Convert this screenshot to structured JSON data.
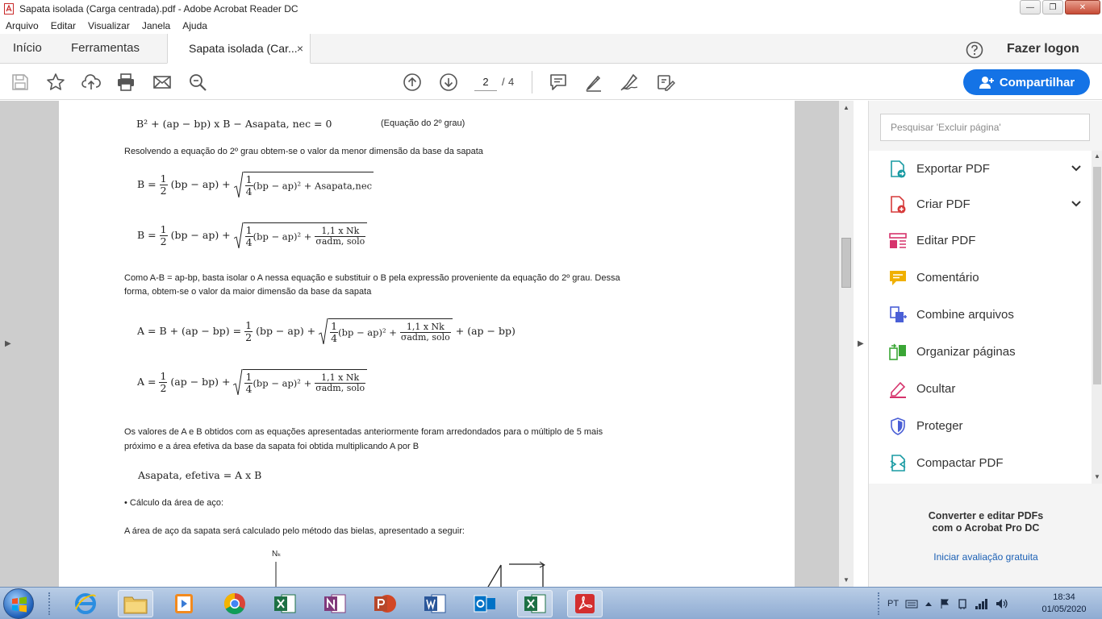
{
  "window": {
    "title": "Sapata isolada (Carga centrada).pdf - Adobe Acrobat Reader DC",
    "minimize": "—",
    "maximize": "❐",
    "close": "✕"
  },
  "menu": [
    "Arquivo",
    "Editar",
    "Visualizar",
    "Janela",
    "Ajuda"
  ],
  "tabs": {
    "home": "Início",
    "tools": "Ferramentas",
    "document": "Sapata isolada (Car...",
    "close": "×"
  },
  "header": {
    "login": "Fazer logon"
  },
  "toolbar": {
    "page_current": "2",
    "page_separator": "/",
    "page_total": "4",
    "share_label": "Compartilhar",
    "icons": [
      "save-icon",
      "star-icon",
      "upload-icon",
      "print-icon",
      "email-icon",
      "zoom-icon",
      "arrow-up-icon",
      "arrow-down-icon",
      "comment-icon",
      "pen-icon",
      "sign-icon",
      "edit-icon"
    ]
  },
  "document": {
    "eq1": {
      "text": "B² + (ap − bp) x B − Asapata, nec = 0",
      "note": "(Equação do 2º grau)"
    },
    "para1": "Resolvendo a equação do 2º grau obtem-se o valor da menor dimensão da base da sapata",
    "eq2": {
      "lhs": "B =",
      "frac_num": "1",
      "frac_den": "2",
      "term1": "(bp − ap) +",
      "inner_num": "1",
      "inner_den": "4",
      "inner_term": "(bp − ap)² + Asapata,nec"
    },
    "eq3": {
      "lhs": "B =",
      "frac_num": "1",
      "frac_den": "2",
      "term1": "(bp − ap) +",
      "inner_num": "1",
      "inner_den": "4",
      "inner_term": "(bp − ap)² +",
      "frac2_num": "1,1 x Nk",
      "frac2_den": "σadm, solo"
    },
    "para2_line1": "Como A-B = ap-bp, basta isolar o A nessa equação e substituir o B pela expressão proveniente da equação do 2º grau. Dessa",
    "para2_line2": "forma, obtem-se o valor da maior dimensão da base da sapata",
    "eq4": {
      "lhs": "A = B + (ap − bp) =",
      "frac_num": "1",
      "frac_den": "2",
      "term1": "(bp − ap) +",
      "inner_num": "1",
      "inner_den": "4",
      "inner_term": "(bp − ap)² +",
      "frac2_num": "1,1 x Nk",
      "frac2_den": "σadm, solo",
      "tail": "+ (ap − bp)"
    },
    "eq5": {
      "lhs": "A =",
      "frac_num": "1",
      "frac_den": "2",
      "term1": "(ap − bp) +",
      "inner_num": "1",
      "inner_den": "4",
      "inner_term": "(bp − ap)² +",
      "frac2_num": "1,1 x Nk",
      "frac2_den": "σadm, solo"
    },
    "para3_line1": "Os valores de A e B obtidos com as equações apresentadas anteriormente foram arredondados para o múltiplo de 5 mais",
    "para3_line2": "próximo e a área efetiva da base da sapata foi obtida multiplicando A por B",
    "eq6": "Asapata, efetiva = A x B",
    "bullet": "• Cálculo da área de aço:",
    "para4": "A área de aço da sapata será calculado pelo método das bielas, apresentado a seguir:",
    "diagram_label": "Nₖ"
  },
  "right_panel": {
    "search_placeholder": "Pesquisar 'Excluir página'",
    "tools": [
      {
        "label": "Exportar PDF",
        "icon": "export-pdf-icon",
        "color": "#1a9ba3",
        "expandable": true
      },
      {
        "label": "Criar PDF",
        "icon": "create-pdf-icon",
        "color": "#d63a3a",
        "expandable": true
      },
      {
        "label": "Editar PDF",
        "icon": "edit-pdf-icon",
        "color": "#d6336c",
        "expandable": false
      },
      {
        "label": "Comentário",
        "icon": "comment-icon",
        "color": "#f0b000",
        "expandable": false
      },
      {
        "label": "Combine arquivos",
        "icon": "combine-files-icon",
        "color": "#4a5fd6",
        "expandable": false
      },
      {
        "label": "Organizar páginas",
        "icon": "organize-pages-icon",
        "color": "#3aa635",
        "expandable": false
      },
      {
        "label": "Ocultar",
        "icon": "redact-icon",
        "color": "#d6336c",
        "expandable": false
      },
      {
        "label": "Proteger",
        "icon": "protect-icon",
        "color": "#4a5fd6",
        "expandable": false
      },
      {
        "label": "Compactar PDF",
        "icon": "compress-pdf-icon",
        "color": "#1a9ba3",
        "expandable": false
      }
    ],
    "promo_line1": "Converter e editar PDFs",
    "promo_line2": "com o Acrobat Pro DC",
    "promo_link": "Iniciar avaliação gratuita"
  },
  "taskbar": {
    "language": "PT",
    "time": "18:34",
    "date": "01/05/2020",
    "apps": [
      "file-explorer-icon",
      "media-player-icon",
      "chrome-icon",
      "excel-icon",
      "onenote-icon",
      "powerpoint-icon",
      "word-icon",
      "outlook-icon",
      "excel-icon",
      "acrobat-icon"
    ]
  },
  "colors": {
    "accent": "#1473e6",
    "taskbar": "#a9c0df",
    "panel": "#f4f4f4"
  }
}
